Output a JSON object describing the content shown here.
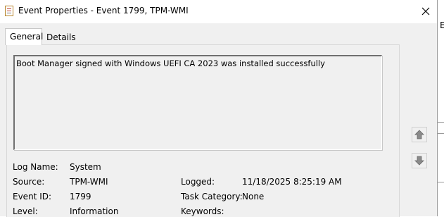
{
  "window": {
    "title": "Event Properties - Event 1799, TPM-WMI"
  },
  "tabs": [
    {
      "label": "General",
      "active": true
    },
    {
      "label": "Details",
      "active": false
    }
  ],
  "description": "Boot Manager signed with Windows UEFI CA 2023 was installed successfully",
  "fields": {
    "log_name_label": "Log Name:",
    "log_name_value": "System",
    "source_label": "Source:",
    "source_value": "TPM-WMI",
    "logged_label": "Logged:",
    "logged_value": "11/18/2025 8:25:19 AM",
    "event_id_label": "Event ID:",
    "event_id_value": "1799",
    "task_category_label": "Task Category:",
    "task_category_value": "None",
    "level_label": "Level:",
    "level_value": "Information",
    "keywords_label": "Keywords:"
  },
  "background_window": {
    "edge_text": "E"
  },
  "icons": {
    "close": "close-icon",
    "up": "arrow-up-icon",
    "down": "arrow-down-icon",
    "app": "event-properties-icon"
  }
}
